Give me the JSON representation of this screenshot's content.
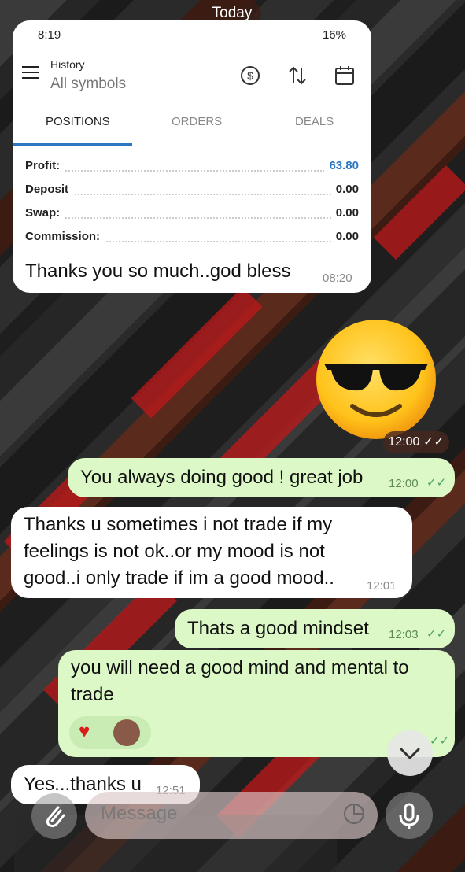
{
  "day_label": "Today",
  "screenshot": {
    "status_time": "8:19",
    "status_battery": "16%",
    "title": "History",
    "subtitle": "All symbols",
    "tabs": [
      "POSITIONS",
      "ORDERS",
      "DEALS"
    ],
    "rows": [
      {
        "label": "Profit:",
        "value": "63.80"
      },
      {
        "label": "Deposit",
        "value": "0.00"
      },
      {
        "label": "Swap:",
        "value": "0.00"
      },
      {
        "label": "Commission:",
        "value": "0.00"
      }
    ],
    "caption": "Thanks you so much..god bless",
    "time": "08:20"
  },
  "emoji_time": "12:00",
  "messages": [
    {
      "text": "You always doing good ! great job",
      "time": "12:00"
    },
    {
      "text": "Thanks u sometimes i not trade if my feelings is not ok..or my mood is not good..i only trade if im a good mood..",
      "time": "12:01"
    },
    {
      "text": "Thats a good mindset",
      "time": "12:03"
    },
    {
      "text": "you will need a good mind and mental to trade"
    },
    {
      "text": "Yes...thanks u",
      "time": "12:51"
    }
  ],
  "composer": {
    "placeholder": "Message"
  },
  "colors": {
    "accent": "#2d77c2",
    "outgoing": "#dcf8c6",
    "incoming": "#ffffff"
  }
}
